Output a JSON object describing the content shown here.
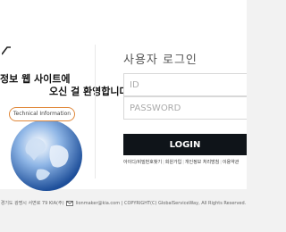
{
  "welcome": {
    "line1": "정보 웹 사이트에",
    "line2": "오신 걸 환영합니다",
    "bubble": "Technical Information"
  },
  "login": {
    "title": "사용자 로그인",
    "id_placeholder": "ID",
    "pw_placeholder": "PASSWORD",
    "button": "LOGIN",
    "links": [
      "아이디/비밀번호찾기",
      "회원가입",
      "개인정보 처리방침",
      "이용약관"
    ]
  },
  "footer": {
    "address": "경기도 광명시 서면로 79 KIA(주)",
    "email": "lionmaker@kia.com",
    "copyright": "COPYRIGHT(C) GlobalServiceWay, All Rights Reserved."
  },
  "colors": {
    "accent": "#e0883a",
    "button_bg": "#0f1419",
    "page_bg": "#f2f2f2"
  }
}
